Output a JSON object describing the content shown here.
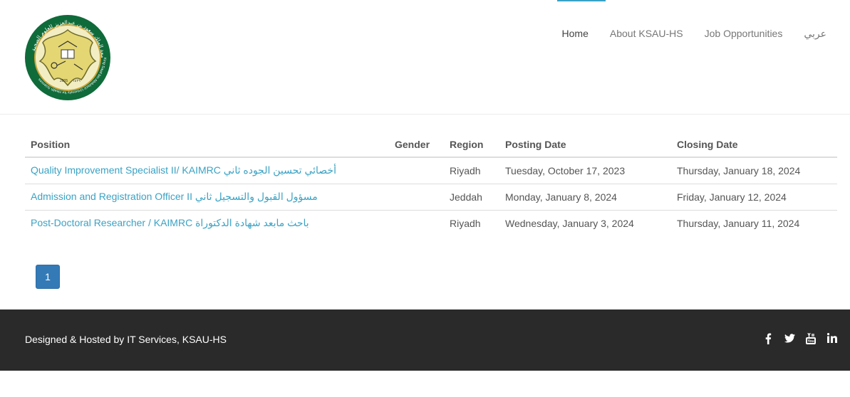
{
  "nav": {
    "items": [
      {
        "label": "Home",
        "active": true
      },
      {
        "label": "About KSAU-HS"
      },
      {
        "label": "Job Opportunities"
      },
      {
        "label": "عربي"
      }
    ]
  },
  "logo": {
    "arabic_ring_text": "جامعة الملك سعود بن عبدالعزيز للعلوم الصحية",
    "english_ring_text": "King Saud bin Abdulaziz University for Health Sciences",
    "year_left": "2005",
    "year_right": "١٤٢٦",
    "colors": {
      "ring": "#0f6b3a",
      "inner": "#e4d672",
      "accent": "#c9a43a"
    }
  },
  "table": {
    "headers": [
      "Position",
      "Gender",
      "Region",
      "Posting Date",
      "Closing Date"
    ],
    "rows": [
      {
        "position": "Quality Improvement Specialist II/ KAIMRC أخصائي تحسين الجوده ثاني",
        "gender": "",
        "region": "Riyadh",
        "posting": "Tuesday, October 17, 2023",
        "closing": "Thursday, January 18, 2024"
      },
      {
        "position": "Admission and Registration Officer II مسؤول القبول والتسجيل ثاني",
        "gender": "",
        "region": "Jeddah",
        "posting": "Monday, January 8, 2024",
        "closing": "Friday, January 12, 2024"
      },
      {
        "position": "Post-Doctoral Researcher / KAIMRC باحث مابعد شهادة الدكتوراة",
        "gender": "",
        "region": "Riyadh",
        "posting": "Wednesday, January 3, 2024",
        "closing": "Thursday, January 11, 2024"
      }
    ]
  },
  "pagination": {
    "current": "1"
  },
  "footer": {
    "text": "Designed & Hosted by IT Services, KSAU-HS",
    "social": [
      "facebook-icon",
      "twitter-icon",
      "youtube-icon",
      "linkedin-icon"
    ]
  },
  "colors": {
    "link": "#3aa2c4",
    "page_button": "#337ab7",
    "footer_bg": "#2a2a2a"
  }
}
